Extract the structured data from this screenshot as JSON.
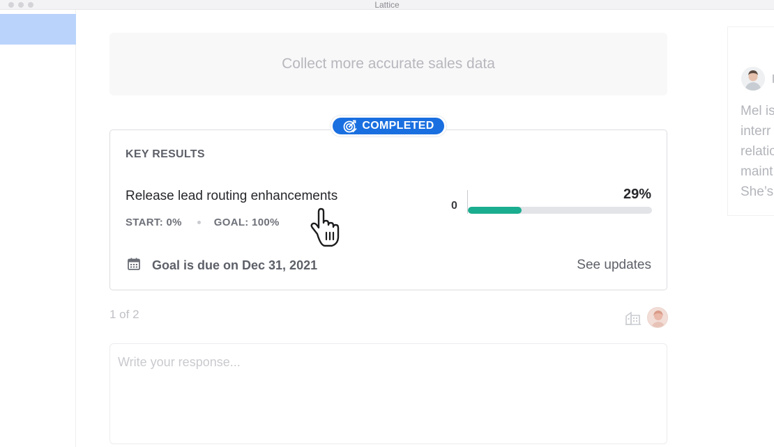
{
  "window": {
    "title": "Lattice"
  },
  "objective": {
    "text": "Collect more accurate sales data"
  },
  "status_badge": {
    "label": "COMPLETED",
    "color": "#1a6fe0",
    "icon": "target-check-icon"
  },
  "key_results": {
    "heading": "KEY RESULTS",
    "item": {
      "name": "Release lead routing enhancements",
      "start_label": "START: 0%",
      "goal_label": "GOAL: 100%",
      "progress_start": "0",
      "progress_percent_text": "29%",
      "progress_fraction": 0.29,
      "progress_color": "#1bad8f"
    },
    "due_text": "Goal is due on Dec 31, 2021",
    "see_updates_label": "See updates"
  },
  "pager": {
    "text": "1 of 2"
  },
  "response": {
    "placeholder": "Write your response..."
  },
  "right_panel": {
    "bio_lines": "Mel is\ninterr\nrelatio\nmaint\nShe’s"
  },
  "icons": {
    "calendar": "calendar-icon",
    "building": "building-icon",
    "cursor": "hand-pointer-icon"
  }
}
